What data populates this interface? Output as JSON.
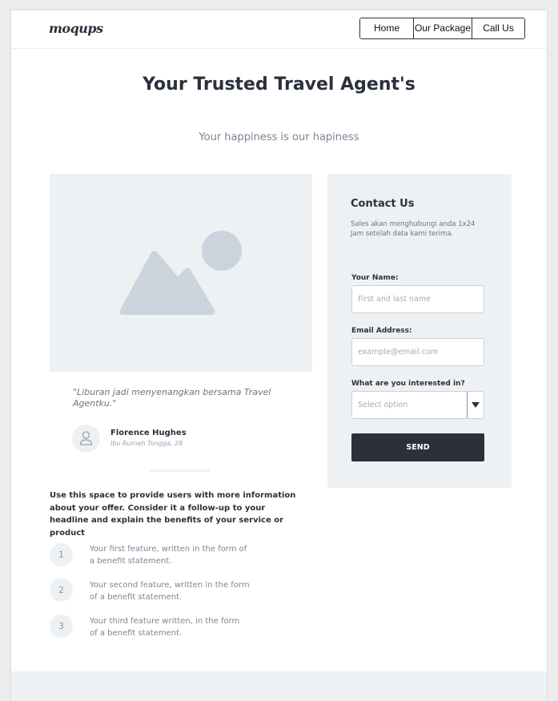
{
  "header": {
    "logo": "moqups",
    "nav": [
      "Home",
      "Our Package",
      "Call Us"
    ]
  },
  "hero": {
    "title": "Your Trusted Travel Agent's",
    "subtitle": "Your happiness is our hapiness"
  },
  "testimonial": {
    "quote": "\"Liburan jadi menyenangkan bersama Travel Agentku.\"",
    "name": "Florence Hughes",
    "role": "Ibu Rumah Tongga, 28"
  },
  "info_text": "Use this space to provide users with more information about your offer. Consider it a follow-up to your headline and explain the benefits of your service or product",
  "features": [
    {
      "num": "1",
      "text": "Your first feature, written in the form of a benefit statement."
    },
    {
      "num": "2",
      "text": "Your second feature, written in the form of a benefit statement."
    },
    {
      "num": "3",
      "text": "Your third feature written, in the form of a benefit statement."
    }
  ],
  "contact": {
    "title": "Contact Us",
    "description": "Sales akan menghubungi anda 1x24 Jam setelah data kami terima.",
    "name_label": "Your Name:",
    "name_placeholder": "First and last name",
    "email_label": "Email Address:",
    "email_placeholder": "example@email.com",
    "interest_label": "What are you interested in?",
    "interest_placeholder": "Select option",
    "send_label": "SEND"
  },
  "colors": {
    "dark": "#2b313b",
    "panel": "#eef1f4",
    "placeholder_shape": "#cbd3dc"
  },
  "icons": [
    "image-placeholder-icon",
    "user-icon",
    "chevron-down-icon"
  ]
}
